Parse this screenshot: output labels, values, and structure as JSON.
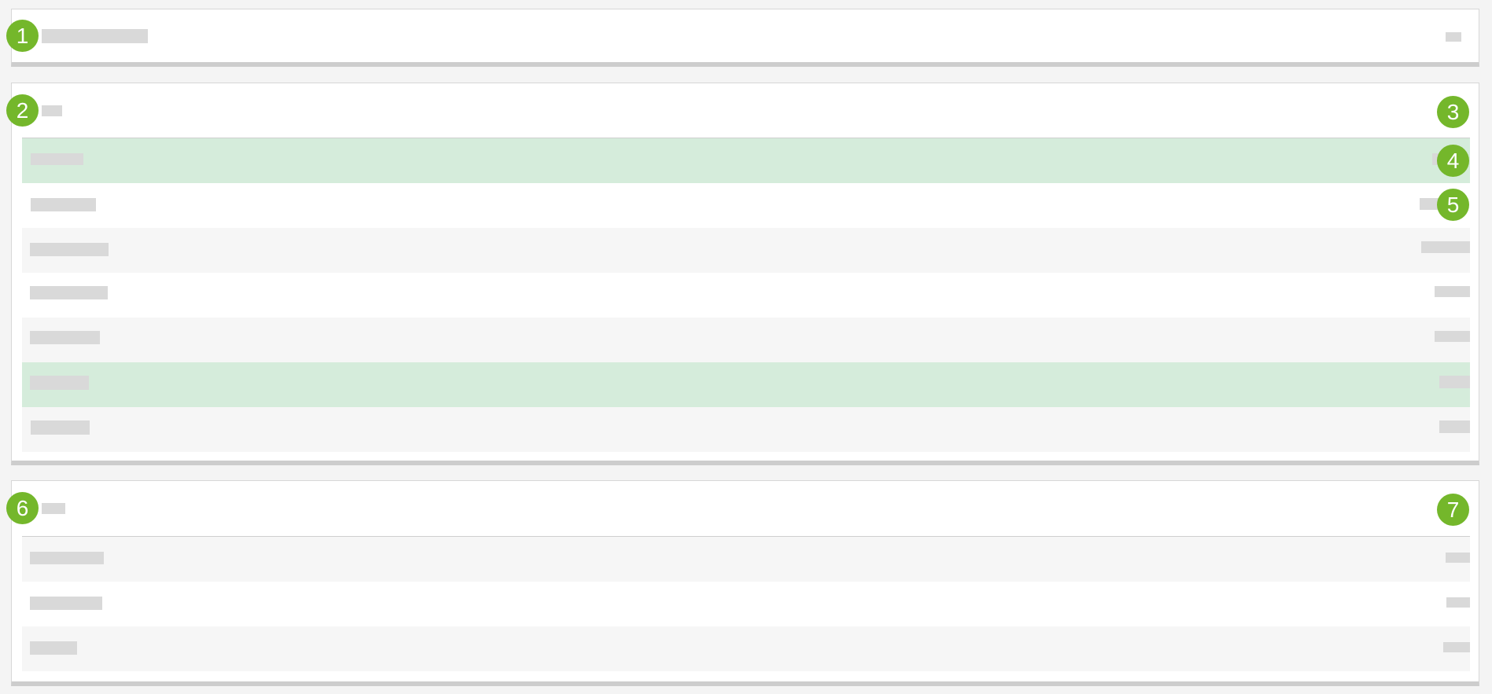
{
  "callouts": [
    "1",
    "2",
    "3",
    "4",
    "5",
    "6",
    "7"
  ],
  "colors": {
    "page_background": "#f4f4f4",
    "panel_background": "#ffffff",
    "placeholder": "#d9d9d9",
    "row_alternate": "#f6f6f6",
    "row_highlight": "#d5ecdb",
    "callout_badge": "#74b72b"
  },
  "sections": [
    {
      "name": "header-bar",
      "rows": 0
    },
    {
      "name": "list-section-1",
      "rows": 7,
      "highlighted_rows": [
        1,
        6
      ]
    },
    {
      "name": "list-section-2",
      "rows": 3,
      "highlighted_rows": []
    }
  ]
}
